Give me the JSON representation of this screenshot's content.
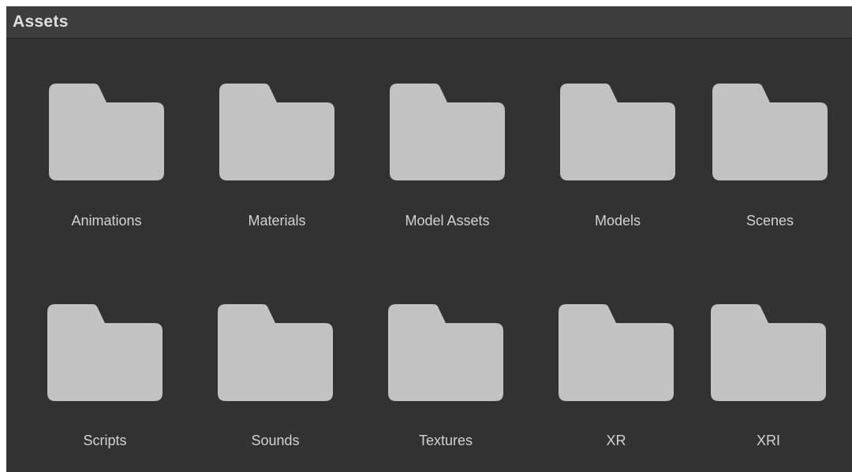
{
  "window": {
    "title": "Assets"
  },
  "colors": {
    "panel_background": "#323232",
    "header_background": "#3d3d3d",
    "folder_icon": "#c2c2c2",
    "label_text": "#d2d2d2"
  },
  "folders": [
    {
      "label": "Animations",
      "icon": "folder-icon"
    },
    {
      "label": "Materials",
      "icon": "folder-icon"
    },
    {
      "label": "Model Assets",
      "icon": "folder-icon"
    },
    {
      "label": "Models",
      "icon": "folder-icon"
    },
    {
      "label": "Scenes",
      "icon": "folder-icon"
    },
    {
      "label": "Scripts",
      "icon": "folder-icon"
    },
    {
      "label": "Sounds",
      "icon": "folder-icon"
    },
    {
      "label": "Textures",
      "icon": "folder-icon"
    },
    {
      "label": "XR",
      "icon": "folder-icon"
    },
    {
      "label": "XRI",
      "icon": "folder-icon"
    }
  ]
}
